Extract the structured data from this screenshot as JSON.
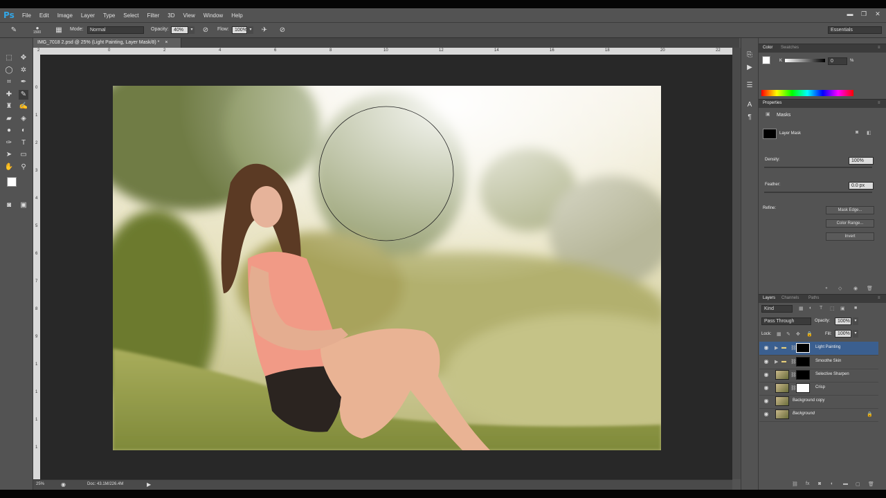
{
  "app": {
    "logo": "Ps"
  },
  "menubar": {
    "items": [
      "File",
      "Edit",
      "Image",
      "Layer",
      "Type",
      "Select",
      "Filter",
      "3D",
      "View",
      "Window",
      "Help"
    ]
  },
  "window_controls": {
    "minimize": "▬",
    "restore": "❐",
    "close": "✕"
  },
  "options_bar": {
    "brush_size": "1500",
    "mode_label": "Mode:",
    "mode_value": "Normal",
    "opacity_label": "Opacity:",
    "opacity_value": "40%",
    "flow_label": "Flow:",
    "flow_value": "100%",
    "workspace": "Essentials"
  },
  "document": {
    "tab_title": "IMG_7018 2.psd @ 25% (Light Painting, Layer Mask/8) *",
    "close": "×"
  },
  "ruler": {
    "h_ticks": [
      "2",
      "0",
      "2",
      "4",
      "6",
      "8",
      "10",
      "12",
      "14",
      "16",
      "18",
      "20",
      "22"
    ],
    "v_ticks": [
      "0",
      "1",
      "2",
      "3",
      "4",
      "5",
      "6",
      "7",
      "8",
      "9",
      "1",
      "1",
      "1",
      "1"
    ]
  },
  "status": {
    "zoom": "25%",
    "doc": "Doc: 43.1M/226.4M"
  },
  "color_panel": {
    "tabs": [
      "Color",
      "Swatches"
    ],
    "channel_label": "K",
    "value": "0",
    "unit": "%"
  },
  "properties_panel": {
    "tab": "Properties",
    "title": "Masks",
    "mask_label": "Layer Mask",
    "density_label": "Density:",
    "density_value": "100%",
    "feather_label": "Feather:",
    "feather_value": "0.0 px",
    "refine_label": "Refine:",
    "btn_mask_edge": "Mask Edge...",
    "btn_color_range": "Color Range...",
    "btn_invert": "Invert"
  },
  "layers_panel": {
    "tabs": [
      "Layers",
      "Channels",
      "Paths"
    ],
    "kind": "Kind",
    "blend": "Pass Through",
    "opacity_label": "Opacity:",
    "opacity_value": "100%",
    "lock_label": "Lock:",
    "fill_label": "Fill:",
    "fill_value": "100%",
    "layers": [
      {
        "name": "Light Painting"
      },
      {
        "name": "Smoothe Skin"
      },
      {
        "name": "Selective Sharpen"
      },
      {
        "name": "Crisp"
      },
      {
        "name": "Background copy"
      },
      {
        "name": "Background"
      }
    ]
  }
}
